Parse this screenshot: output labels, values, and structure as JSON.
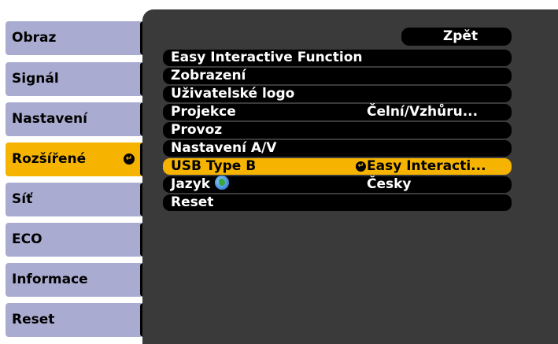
{
  "tabs": [
    {
      "label": "Obraz",
      "active": false
    },
    {
      "label": "Signál",
      "active": false
    },
    {
      "label": "Nastavení",
      "active": false
    },
    {
      "label": "Rozšířené",
      "active": true
    },
    {
      "label": "Síť",
      "active": false
    },
    {
      "label": "ECO",
      "active": false
    },
    {
      "label": "Informace",
      "active": false
    },
    {
      "label": "Reset",
      "active": false
    }
  ],
  "back_label": "Zpět",
  "menu": [
    {
      "label": "Easy Interactive Function",
      "value": ""
    },
    {
      "label": "Zobrazení",
      "value": ""
    },
    {
      "label": "Uživatelské logo",
      "value": ""
    },
    {
      "label": "Projekce",
      "value": "Čelní/Vzhůru..."
    },
    {
      "label": "Provoz",
      "value": ""
    },
    {
      "label": "Nastavení A/V",
      "value": ""
    },
    {
      "label": "USB Type B",
      "value": "Easy Interacti...",
      "selected": true
    },
    {
      "label": "Jazyk",
      "value": "Česky",
      "icon": "globe-icon"
    },
    {
      "label": "Reset",
      "value": ""
    }
  ],
  "colors": {
    "tab_bg": "#a9acd0",
    "active_tab_bg": "#f6b400",
    "panel_bg": "#3a3a3a",
    "row_bg": "#000000",
    "selected_row_bg": "#f6b400"
  }
}
